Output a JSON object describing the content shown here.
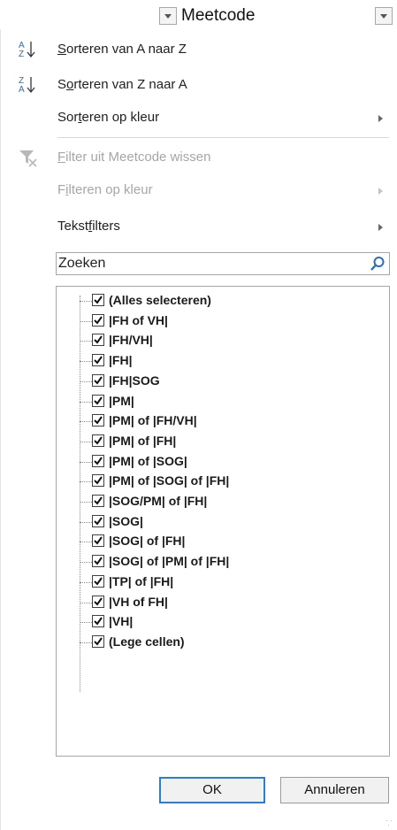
{
  "header": {
    "column_title": "Meetcode"
  },
  "menu": {
    "sort_az": {
      "pre": "",
      "u": "S",
      "post": "orteren van A naar Z",
      "icon": "sort-ascending-icon"
    },
    "sort_za": {
      "pre": "S",
      "u": "o",
      "post": "rteren van Z naar A",
      "icon": "sort-descending-icon"
    },
    "sort_color": {
      "pre": "Sor",
      "u": "t",
      "post": "eren op kleur"
    },
    "clear_filter": {
      "pre": "",
      "u": "F",
      "post": "ilter uit Meetcode wissen",
      "icon": "clear-filter-icon"
    },
    "filter_color": {
      "pre": "F",
      "u": "i",
      "post": "lteren op kleur"
    },
    "text_filters": {
      "pre": "Tekst",
      "u": "f",
      "post": "ilters"
    }
  },
  "search": {
    "placeholder": "Zoeken"
  },
  "checklist": {
    "items": [
      "(Alles selecteren)",
      "|FH of VH|",
      "|FH/VH|",
      "|FH|",
      "|FH|SOG",
      "|PM|",
      "|PM| of |FH/VH|",
      "|PM| of |FH|",
      "|PM| of |SOG|",
      "|PM| of |SOG| of |FH|",
      "|SOG/PM| of |FH|",
      "|SOG|",
      "|SOG| of |FH|",
      "|SOG| of |PM| of |FH|",
      "|TP| of |FH|",
      "|VH of FH|",
      "|VH|",
      "(Lege cellen)"
    ]
  },
  "buttons": {
    "ok": "OK",
    "cancel": "Annuleren"
  },
  "colors": {
    "accent": "#2a7fd3",
    "disabled_text": "#a6a6a6"
  }
}
